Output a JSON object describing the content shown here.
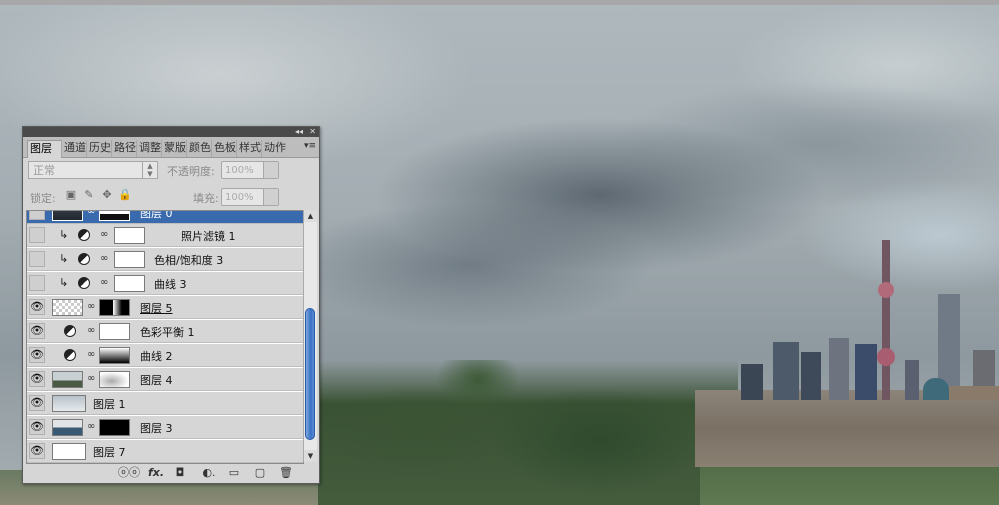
{
  "panel": {
    "collapse_glyph": "◂◂",
    "close_glyph": "✕",
    "tabs": [
      "图层",
      "通道",
      "历史",
      "路径",
      "调整",
      "蒙版",
      "颜色",
      "色板",
      "样式",
      "动作"
    ],
    "active_tab": "图层",
    "menu_glyph": "▾≡",
    "blend_mode": "正常",
    "opacity_label": "不透明度:",
    "opacity_value": "100%",
    "lock_label": "锁定:",
    "fill_label": "填充:",
    "fill_value": "100%",
    "icons": {
      "lock_transparent": "checker-icon",
      "lock_image": "brush-icon",
      "lock_position": "move-icon",
      "lock_all": "lock-icon",
      "link": "link-icon",
      "fx": "fx-icon",
      "mask": "add-mask-icon",
      "adjustment": "new-adjustment-icon",
      "group": "folder-icon",
      "new_layer": "new-layer-icon",
      "delete": "trash-icon"
    },
    "layers": [
      {
        "label": "图层 0",
        "visible": false,
        "selected": true,
        "type": "pixel-mask"
      },
      {
        "label": "照片滤镜 1",
        "visible": false,
        "clipped": true,
        "type": "adjustment"
      },
      {
        "label": "色相/饱和度 3",
        "visible": false,
        "clipped": true,
        "type": "adjustment"
      },
      {
        "label": "曲线 3",
        "visible": false,
        "clipped": true,
        "type": "adjustment"
      },
      {
        "label": "图层 5",
        "visible": true,
        "type": "pixel-mask"
      },
      {
        "label": "色彩平衡 1",
        "visible": true,
        "type": "adjustment"
      },
      {
        "label": "曲线 2",
        "visible": true,
        "type": "adjustment"
      },
      {
        "label": "图层 4",
        "visible": true,
        "type": "pixel-mask"
      },
      {
        "label": "图层 1",
        "visible": true,
        "type": "pixel"
      },
      {
        "label": "图层 3",
        "visible": true,
        "type": "pixel-mask"
      },
      {
        "label": "图层 7",
        "visible": true,
        "type": "pixel"
      }
    ],
    "bottom_icons": [
      "ⓞⓞ",
      "fx.",
      "◘",
      "◐.",
      "▭",
      "▢",
      "🗑"
    ]
  },
  "colors": {
    "selected_row": "#3a6aae",
    "panel_bg": "#d6d6d6",
    "scroll_thumb": "#3a70c4"
  }
}
